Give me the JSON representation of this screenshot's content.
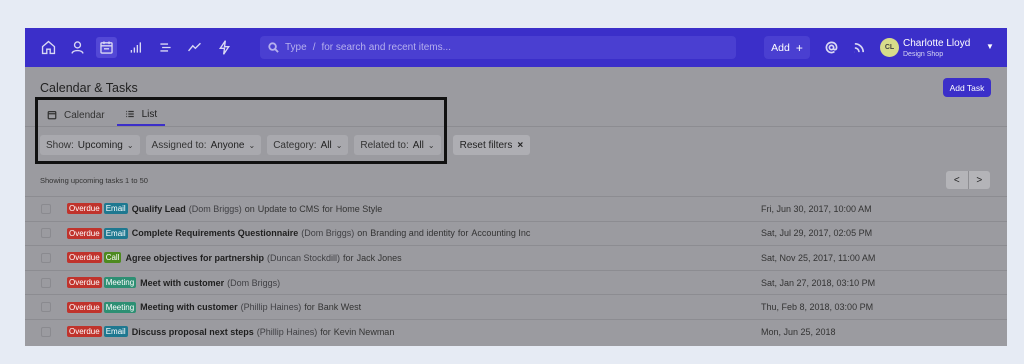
{
  "topbar": {
    "search_placeholder": "Type",
    "search_slash": "/",
    "search_hint": "for search and recent items...",
    "add_label": "Add",
    "add_plus": "+",
    "user_initials": "CL",
    "user_name": "Charlotte Lloyd",
    "user_org": "Design Shop",
    "accent_color": "#3b2fc9"
  },
  "page": {
    "title": "Calendar & Tasks",
    "add_task_label": "Add Task"
  },
  "tabs": [
    {
      "label": "Calendar",
      "icon": "calendar-icon",
      "active": false
    },
    {
      "label": "List",
      "icon": "list-icon",
      "active": true
    }
  ],
  "filters": {
    "show_label": "Show:",
    "show_value": "Upcoming",
    "assigned_label": "Assigned to:",
    "assigned_value": "Anyone",
    "category_label": "Category:",
    "category_value": "All",
    "related_label": "Related to:",
    "related_value": "All",
    "reset_label": "Reset filters",
    "reset_x": "×"
  },
  "list": {
    "showing_text": "Showing upcoming tasks 1 to 50",
    "pager_prev": "<",
    "pager_next": ">"
  },
  "tasks": [
    {
      "status": "Overdue",
      "type": "Email",
      "title": "Qualify Lead",
      "person": "(Dom Briggs)",
      "prep1": "on",
      "link1": "Update to CMS",
      "prep2": "for",
      "link2": "Home Style",
      "date": "Fri, Jun 30, 2017, 10:00 AM"
    },
    {
      "status": "Overdue",
      "type": "Email",
      "title": "Complete Requirements Questionnaire",
      "person": "(Dom Briggs)",
      "prep1": "on",
      "link1": "Branding and identity",
      "prep2": "for",
      "link2": "Accounting Inc",
      "date": "Sat, Jul 29, 2017, 02:05 PM"
    },
    {
      "status": "Overdue",
      "type": "Call",
      "title": "Agree objectives for partnership",
      "person": "(Duncan Stockdill)",
      "prep1": "for",
      "link1": "Jack Jones",
      "prep2": "",
      "link2": "",
      "date": "Sat, Nov 25, 2017, 11:00 AM"
    },
    {
      "status": "Overdue",
      "type": "Meeting",
      "title": "Meet with customer",
      "person": "(Dom Briggs)",
      "prep1": "",
      "link1": "",
      "prep2": "",
      "link2": "",
      "date": "Sat, Jan 27, 2018, 03:10 PM"
    },
    {
      "status": "Overdue",
      "type": "Meeting",
      "title": "Meeting with customer",
      "person": "(Phillip Haines)",
      "prep1": "for",
      "link1": "Bank West",
      "prep2": "",
      "link2": "",
      "date": "Thu, Feb 8, 2018, 03:00 PM"
    },
    {
      "status": "Overdue",
      "type": "Email",
      "title": "Discuss proposal next steps",
      "person": "(Phillip Haines)",
      "prep1": "for",
      "link1": "Kevin Newman",
      "prep2": "",
      "link2": "",
      "date": "Mon, Jun 25, 2018"
    }
  ]
}
